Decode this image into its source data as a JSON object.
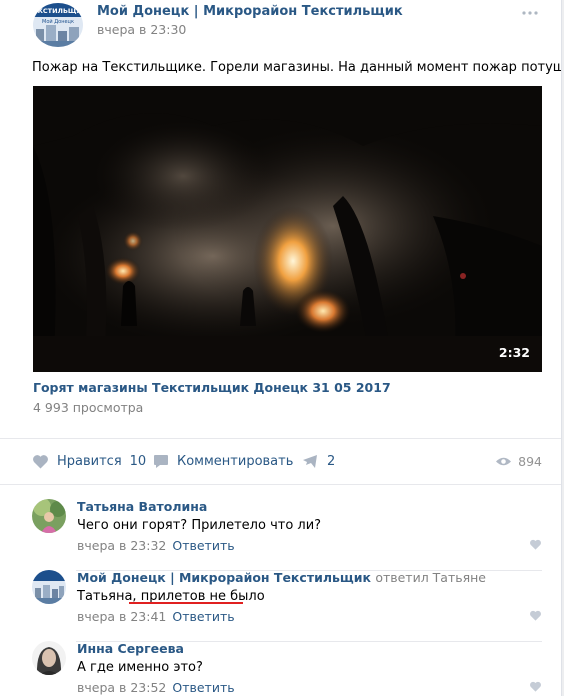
{
  "post": {
    "author": "Мой Донецк | Микрорайон Текстильщик",
    "date": "вчера в 23:30",
    "text": "Пожар на Текстильщике. Горели магазины. На данный момент пожар потушен.",
    "avatar_text_top": "ТЕКСТИЛЬЩИК",
    "avatar_text_bottom": "Мой Донецк"
  },
  "video": {
    "duration": "2:32",
    "title": "Горят магазины Текстильщик Донецк 31 05 2017",
    "views": "4 993 просмотра"
  },
  "actions": {
    "like_label": "Нравится",
    "like_count": "10",
    "comment_label": "Комментировать",
    "share_count": "2",
    "views_count": "894"
  },
  "comments": [
    {
      "author": "Татьяна Ватолина",
      "text": "Чего они горят? Прилетело что ли?",
      "date": "вчера в 23:32",
      "reply_label": "Ответить"
    },
    {
      "author": "Мой Донецк | Микрорайон Текстильщик",
      "reply_to": "ответил Татьяне",
      "text": "Татьяна, прилетов не было",
      "date": "вчера в 23:41",
      "reply_label": "Ответить"
    },
    {
      "author": "Инна Сергеева",
      "text": "А где именно это?",
      "date": "вчера в 23:52",
      "reply_label": "Ответить"
    }
  ],
  "colors": {
    "link": "#2a5885",
    "muted": "#828282",
    "underline_annotation": "#e02020"
  },
  "icons": [
    "more-icon",
    "heart-icon",
    "comment-icon",
    "share-icon",
    "eye-icon",
    "play-overlay"
  ]
}
